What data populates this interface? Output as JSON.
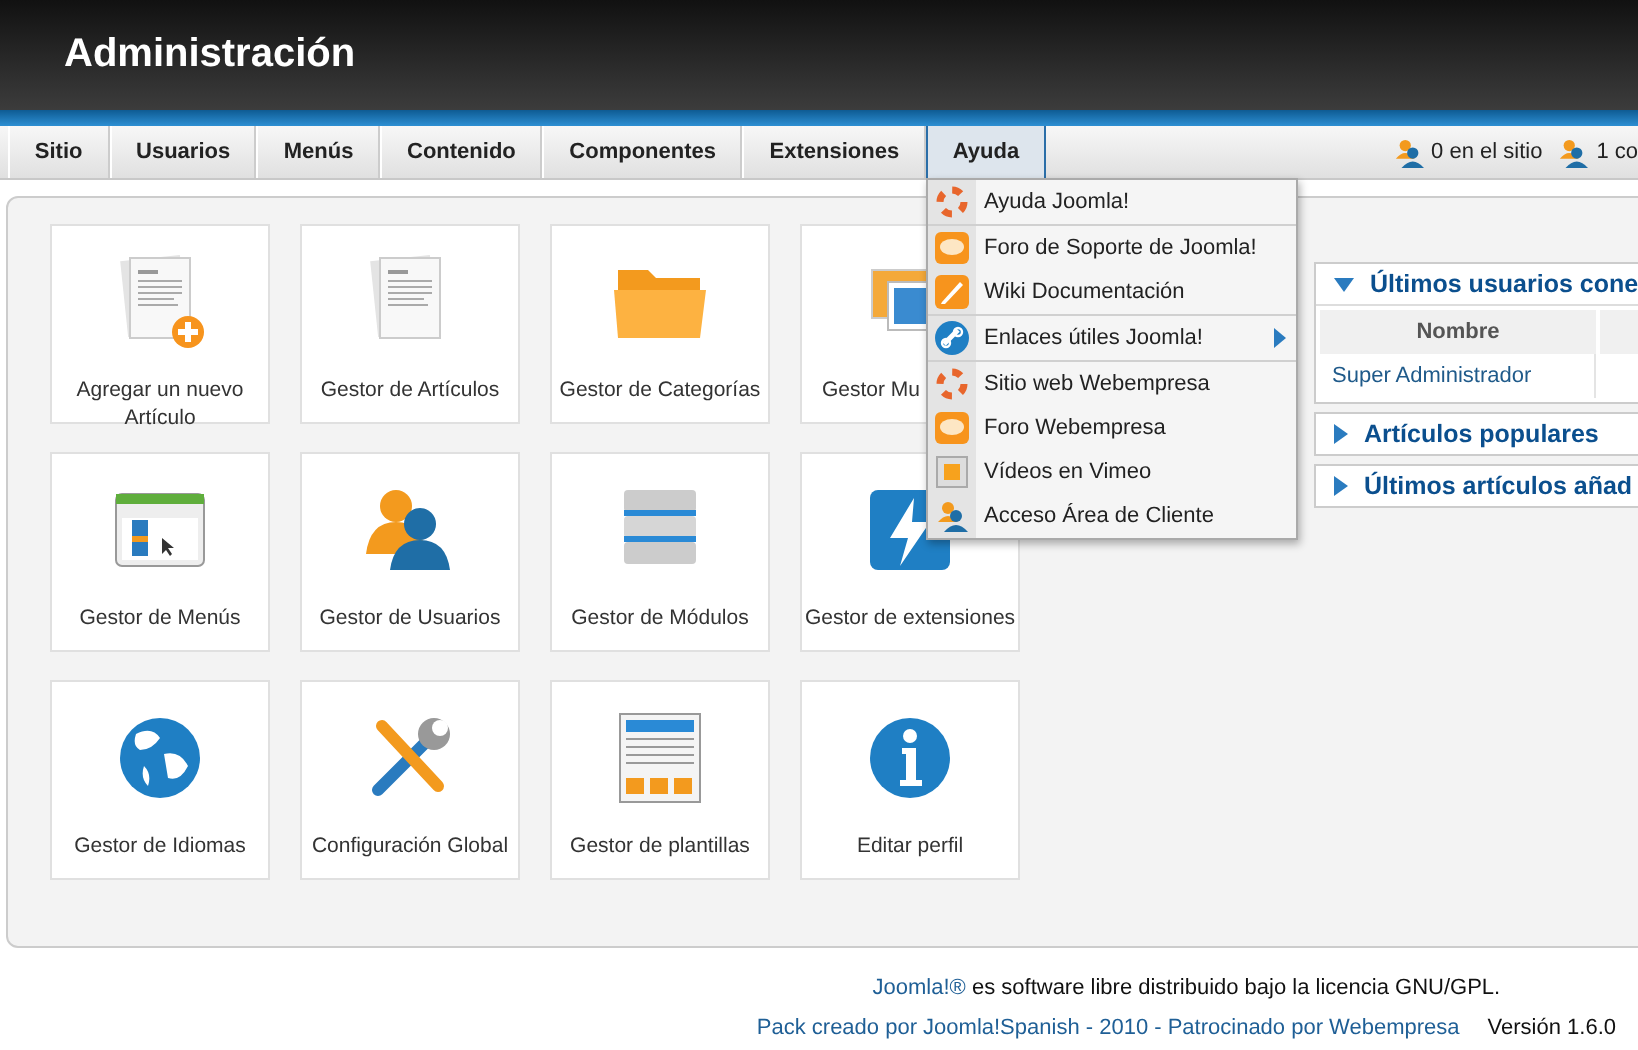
{
  "header": {
    "title": "Administración"
  },
  "menu": [
    {
      "label": "Sitio",
      "selected": false
    },
    {
      "label": "Usuarios",
      "selected": false
    },
    {
      "label": "Menús",
      "selected": false
    },
    {
      "label": "Contenido",
      "selected": false
    },
    {
      "label": "Componentes",
      "selected": false
    },
    {
      "label": "Extensiones",
      "selected": false
    },
    {
      "label": "Ayuda",
      "selected": true
    }
  ],
  "status": [
    "0 en el sitio",
    "1 co"
  ],
  "dropdown": [
    [
      {
        "label": "Ayuda Joomla!",
        "kind": "lifebuoy",
        "submenu": false
      }
    ],
    [
      {
        "label": "Foro de Soporte de Joomla!",
        "kind": "chat",
        "submenu": false
      },
      {
        "label": "Wiki Documentación",
        "kind": "pencil",
        "submenu": false
      }
    ],
    [
      {
        "label": "Enlaces útiles Joomla!",
        "kind": "link",
        "submenu": true
      }
    ],
    [
      {
        "label": "Sitio web Webempresa",
        "kind": "lifebuoy",
        "submenu": false
      },
      {
        "label": "Foro Webempresa",
        "kind": "chat",
        "submenu": false
      },
      {
        "label": "Vídeos en Vimeo",
        "kind": "video",
        "submenu": false
      },
      {
        "label": "Acceso Área de Cliente",
        "kind": "user",
        "submenu": false
      }
    ]
  ],
  "cards": [
    {
      "label": "Agregar un nuevo Artículo",
      "kind": "article-add"
    },
    {
      "label": "Gestor de Artículos",
      "kind": "article"
    },
    {
      "label": "Gestor de Categorías",
      "kind": "folder"
    },
    {
      "label": "Gestor Mu",
      "kind": "media"
    },
    {
      "label": "Gestor de Menús",
      "kind": "menu"
    },
    {
      "label": "Gestor de Usuarios",
      "kind": "users"
    },
    {
      "label": "Gestor de Módulos",
      "kind": "modules"
    },
    {
      "label": "Gestor de extensiones",
      "kind": "extensions"
    },
    {
      "label": "Gestor de Idiomas",
      "kind": "globe"
    },
    {
      "label": "Configuración Global",
      "kind": "tools"
    },
    {
      "label": "Gestor de plantillas",
      "kind": "template"
    },
    {
      "label": "Editar perfil",
      "kind": "info"
    }
  ],
  "panels": [
    {
      "title": "Últimos usuarios cone",
      "expanded": true,
      "table": {
        "columns": [
          "Nombre"
        ],
        "rows": [
          [
            "Super Administrador"
          ]
        ]
      }
    },
    {
      "title": "Artículos populares",
      "expanded": false
    },
    {
      "title": "Últimos artículos añad",
      "expanded": false
    }
  ],
  "footer": {
    "license_link": "Joomla!®",
    "license_text": "es software libre distribuido bajo la licencia GNU/GPL.",
    "credit": "Pack creado por Joomla!Spanish - 2010 - Patrocinado por Webempresa",
    "version": "Versión 1.6.0"
  }
}
